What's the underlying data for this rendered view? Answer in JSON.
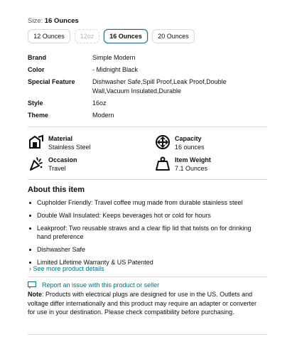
{
  "size": {
    "label": "Size:",
    "selected": "16 Ounces",
    "options": [
      "12 Ounces",
      "12oz",
      "16 Ounces",
      "20 Ounces"
    ]
  },
  "specs": [
    {
      "key": "Brand",
      "value": "Simple Modern"
    },
    {
      "key": "Color",
      "value": "- Midnight Black"
    },
    {
      "key": "Special Feature",
      "value": "Dishwasher Safe,Spill Proof,Leak Proof,Double Wall,Vacuum Insulated,Durable"
    },
    {
      "key": "Style",
      "value": "16oz"
    },
    {
      "key": "Theme",
      "value": "Modern"
    }
  ],
  "features": [
    {
      "title": "Material",
      "value": "Stainless Steel",
      "icon": "material-icon"
    },
    {
      "title": "Capacity",
      "value": "16 ounces",
      "icon": "capacity-icon"
    },
    {
      "title": "Occasion",
      "value": "Travel",
      "icon": "occasion-icon"
    },
    {
      "title": "Item Weight",
      "value": "7.1 Ounces",
      "icon": "weight-icon"
    }
  ],
  "about": {
    "title": "About this item",
    "bullets": [
      "Cupholder Friendly: Travel coffee mug made from durable stainless steel",
      "Double Wall Insulated: Keeps beverages hot or cold for hours",
      "Leakproof: Two reusable straws and a clear flip lid that twists on for drinking hand preference",
      "Dishwasher Safe",
      "Limited Lifetime Warranty & US Patented"
    ],
    "see_more": "See more product details"
  },
  "report": {
    "label": "Report an issue with this product or seller",
    "icon": "flag-icon"
  },
  "note": {
    "label": "Note",
    "text": ": Products with electrical plugs are designed for use in the US. Outlets and voltage differ internationally and this product may require an adapter or converter for use in your destination. Please check compatibility before purchasing."
  },
  "colors": {
    "link": "#007185",
    "selected_border": "#2c6a86",
    "divider": "#d5d9d9"
  }
}
